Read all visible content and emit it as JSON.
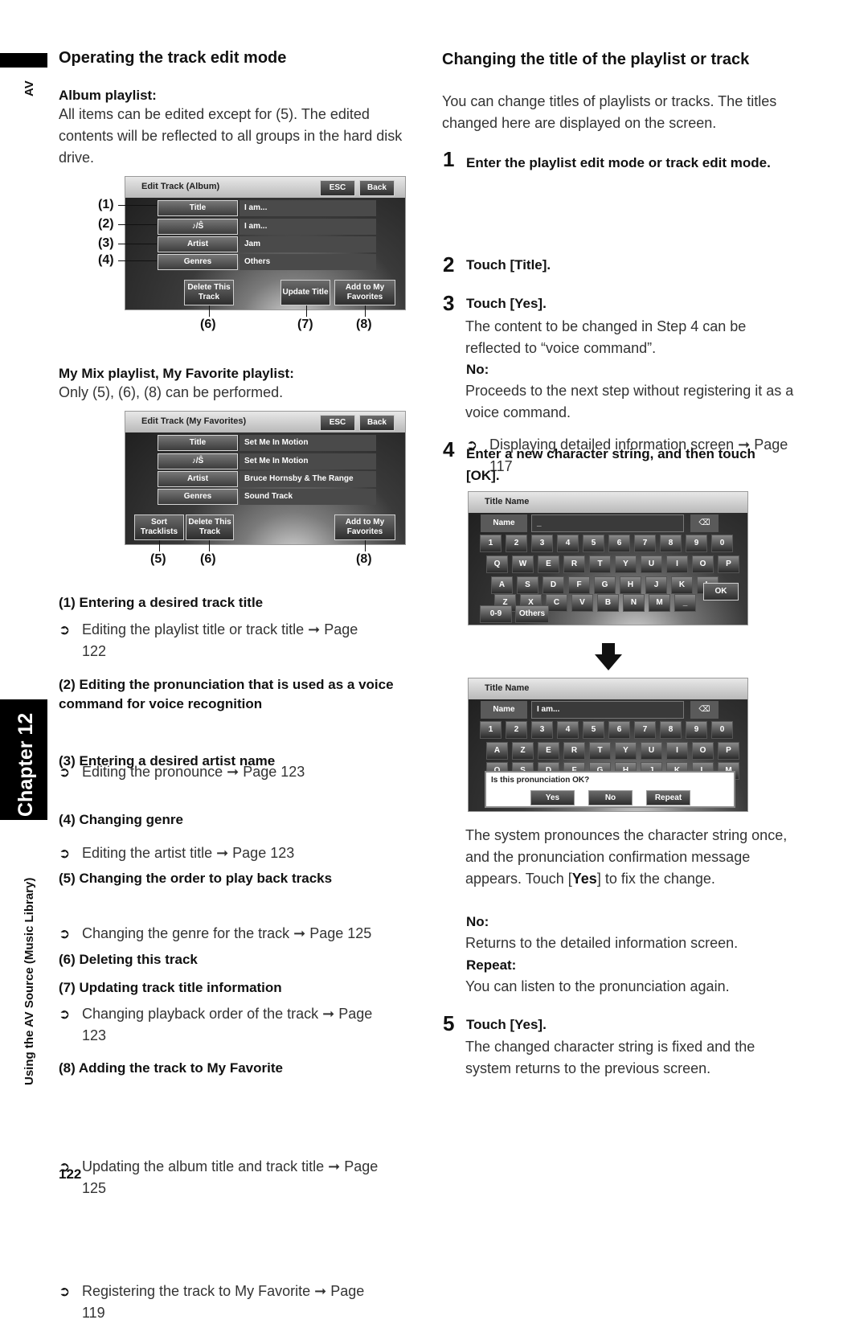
{
  "side": {
    "av_label": "AV",
    "chapter": "Chapter 12",
    "section_title": "Using the AV Source (Music Library)"
  },
  "left": {
    "heading": "Operating the track edit mode",
    "album_playlist": {
      "heading": "Album playlist:",
      "text": "All items can be edited except for (5). The edited contents will be reflected to all groups in the hard disk drive."
    },
    "screen1": {
      "title": "Edit Track (Album)",
      "esc": "ESC",
      "back": "Back",
      "rows": [
        {
          "label": "Title",
          "value": "I am..."
        },
        {
          "label": "♪/Ŝ",
          "value": "I am..."
        },
        {
          "label": "Artist",
          "value": "Jam"
        },
        {
          "label": "Genres",
          "value": "Others"
        }
      ],
      "buttons": {
        "delete": "Delete This Track",
        "update": "Update Title",
        "add_fav": "Add to My Favorites"
      },
      "callouts_left": [
        "(1)",
        "(2)",
        "(3)",
        "(4)"
      ],
      "callouts_bottom": [
        "(6)",
        "(7)",
        "(8)"
      ]
    },
    "mymix": {
      "heading": "My Mix playlist, My Favorite playlist:",
      "text": "Only (5), (6), (8) can be performed."
    },
    "screen2": {
      "title": "Edit Track (My Favorites)",
      "esc": "ESC",
      "back": "Back",
      "rows": [
        {
          "label": "Title",
          "value": "Set Me In Motion"
        },
        {
          "label": "♪/Ŝ",
          "value": "Set Me In Motion"
        },
        {
          "label": "Artist",
          "value": "Bruce Hornsby & The Range"
        },
        {
          "label": "Genres",
          "value": "Sound Track"
        }
      ],
      "buttons": {
        "sort": "Sort Tracklists",
        "delete": "Delete This Track",
        "add_fav": "Add to My Favorites"
      },
      "callouts_bottom": [
        "(5)",
        "(6)",
        "(8)"
      ]
    },
    "items": [
      {
        "heading": "(1) Entering a desired track title",
        "refs": [
          "Editing the playlist title or track title ➞ Page 122"
        ]
      },
      {
        "heading": "(2) Editing the pronunciation that is used as a voice command for voice recognition",
        "refs": [
          "Editing the pronounce ➞ Page 123"
        ]
      },
      {
        "heading": "(3) Entering a desired artist name",
        "refs": [
          "Editing the artist title ➞ Page 123"
        ]
      },
      {
        "heading": "(4) Changing genre",
        "refs": [
          "Changing the genre for the track ➞ Page 125"
        ]
      },
      {
        "heading": "(5) Changing the order to play back tracks",
        "refs": [
          "Changing playback order of the track ➞ Page 123"
        ]
      },
      {
        "heading": "(6) Deleting this track",
        "refs": []
      },
      {
        "heading": "(7) Updating track title information",
        "refs": [
          "Updating the album title and track title ➞ Page 125"
        ]
      },
      {
        "heading": "(8) Adding the track to My Favorite",
        "refs": [
          "Registering the track to My Favorite ➞ Page 119"
        ]
      }
    ],
    "ref_symbol": "➲",
    "page_number": "122"
  },
  "right": {
    "heading": "Changing the title of the playlist or track",
    "intro": "You can change titles of playlists or tracks. The titles changed here are displayed on the screen.",
    "steps": [
      {
        "num": "1",
        "title": "Enter the playlist edit mode or track edit mode.",
        "ref": "Displaying detailed information screen ➞ Page 117"
      },
      {
        "num": "2",
        "title": "Touch [Title]."
      },
      {
        "num": "3",
        "title": "Touch [Yes].",
        "text": "The content to be changed in Step 4 can be reflected to “voice command”.",
        "no_label": "No:",
        "no_text": "Proceeds to the next step without registering it as a voice command."
      },
      {
        "num": "4",
        "title": "Enter a new character string, and then touch [OK]."
      },
      {
        "num": "5",
        "title": "Touch [Yes].",
        "text": "The changed character string is fixed and the system returns to the previous screen."
      }
    ],
    "kbd1": {
      "title": "Title Name",
      "name_label": "Name",
      "name_value": "_",
      "backspace": "⌫",
      "row1": [
        "1",
        "2",
        "3",
        "4",
        "5",
        "6",
        "7",
        "8",
        "9",
        "0"
      ],
      "row2": [
        "Q",
        "W",
        "E",
        "R",
        "T",
        "Y",
        "U",
        "I",
        "O",
        "P"
      ],
      "row3": [
        "A",
        "S",
        "D",
        "F",
        "G",
        "H",
        "J",
        "K",
        "L"
      ],
      "row4": [
        "Z",
        "X",
        "C",
        "V",
        "B",
        "N",
        "M",
        "_"
      ],
      "ok": "OK",
      "mode_09": "0-9",
      "mode_others": "Others"
    },
    "kbd2": {
      "title": "Title Name",
      "name_label": "Name",
      "name_value": "I am...",
      "backspace": "⌫",
      "row1": [
        "1",
        "2",
        "3",
        "4",
        "5",
        "6",
        "7",
        "8",
        "9",
        "0"
      ],
      "row2": [
        "A",
        "Z",
        "E",
        "R",
        "T",
        "Y",
        "U",
        "I",
        "O",
        "P"
      ],
      "row3": [
        "Q",
        "S",
        "D",
        "F",
        "G",
        "H",
        "J",
        "K",
        "L",
        "M"
      ],
      "dialog_msg": "Is this pronunciation OK?",
      "yes": "Yes",
      "no": "No",
      "repeat": "Repeat"
    },
    "after_kbd": {
      "text_pre": "The system pronounces the character string once, and the pronunciation confirmation message appears. Touch [",
      "text_bold": "Yes",
      "text_post": "] to fix the change.",
      "no_label": "No:",
      "no_text": "Returns to the detailed information screen.",
      "repeat_label": "Repeat:",
      "repeat_text": "You can listen to the pronunciation again."
    }
  }
}
